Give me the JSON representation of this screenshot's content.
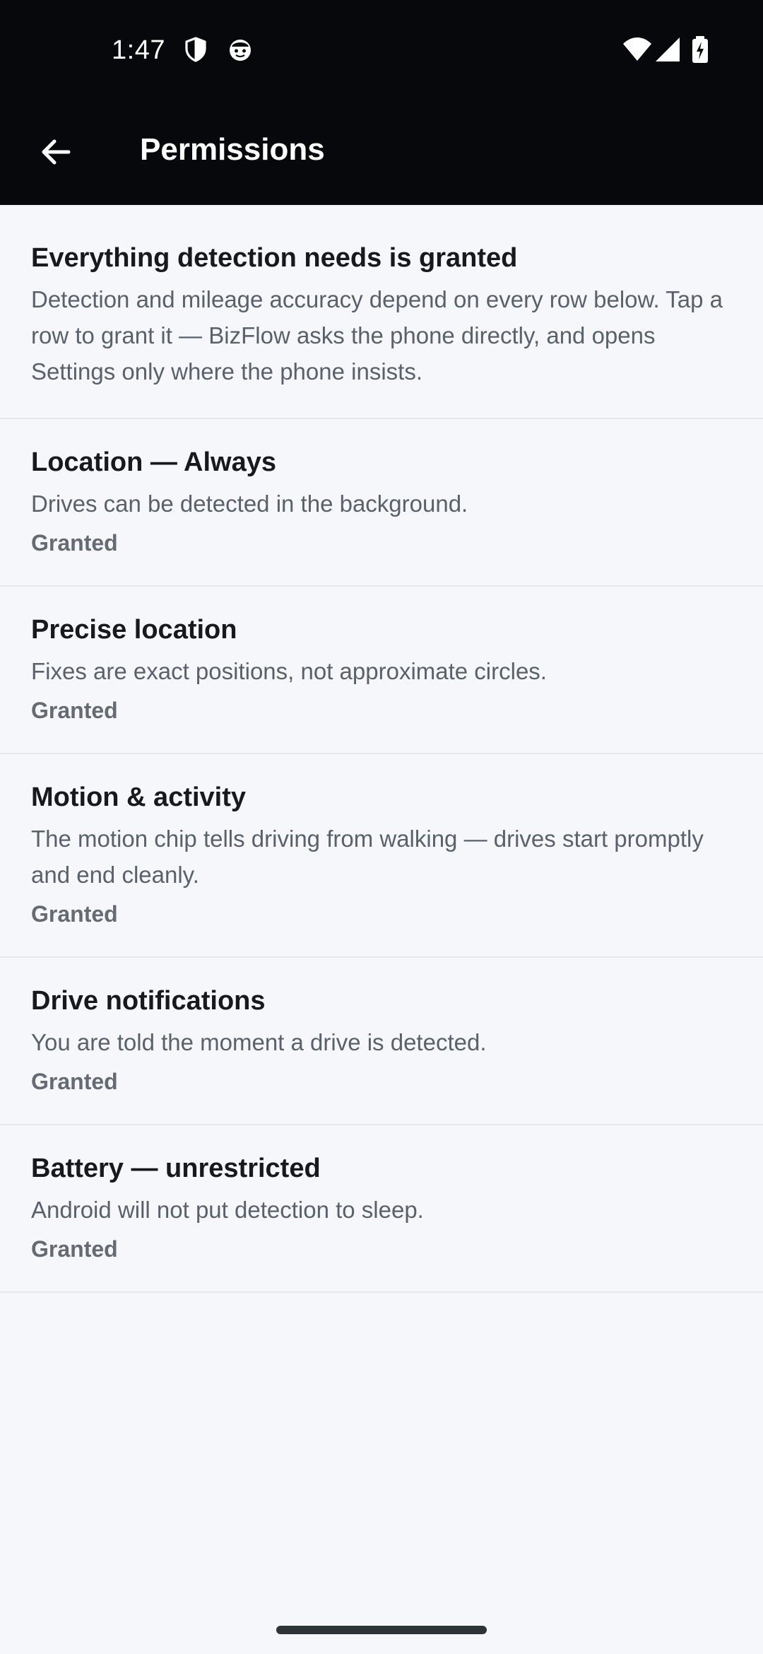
{
  "status_bar": {
    "time": "1:47",
    "icons": [
      "shield-icon",
      "face-icon",
      "wifi-icon",
      "signal-icon",
      "battery-charging-icon"
    ]
  },
  "app_bar": {
    "title": "Permissions",
    "back_icon": "arrow-left-icon"
  },
  "summary": {
    "title": "Everything detection needs is granted",
    "text": "Detection and mileage accuracy depend on every row below. Tap a row to grant it — BizFlow asks the phone directly, and opens Settings only where the phone insists."
  },
  "permissions": [
    {
      "title": "Location — Always",
      "description": "Drives can be detected in the background.",
      "status": "Granted"
    },
    {
      "title": "Precise location",
      "description": "Fixes are exact positions, not approximate circles.",
      "status": "Granted"
    },
    {
      "title": "Motion & activity",
      "description": "The motion chip tells driving from walking — drives start promptly and end cleanly.",
      "status": "Granted"
    },
    {
      "title": "Drive notifications",
      "description": "You are told the moment a drive is detected.",
      "status": "Granted"
    },
    {
      "title": "Battery — unrestricted",
      "description": "Android will not put detection to sleep.",
      "status": "Granted"
    }
  ],
  "colors": {
    "top_bar": "#07080b",
    "background": "#f5f7fa",
    "title_text": "#17191d",
    "body_text": "#5b616b",
    "status_text": "#666b73",
    "divider": "#e6e8ec"
  }
}
